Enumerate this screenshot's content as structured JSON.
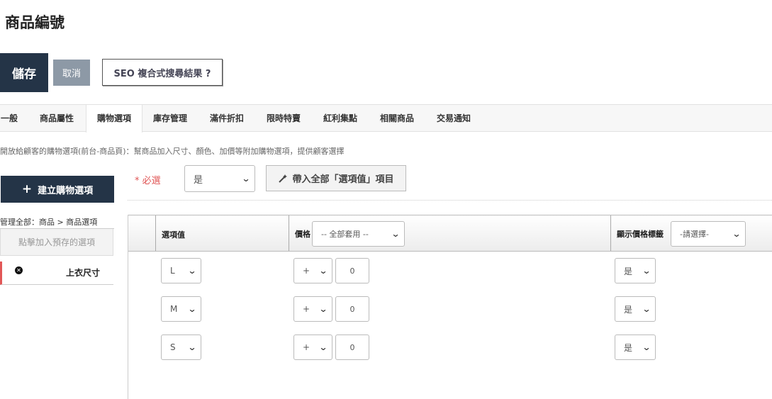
{
  "page": {
    "title": "商品編號"
  },
  "actions": {
    "save": "儲存",
    "cancel": "取消",
    "seo": "SEO 複合式搜尋結果 ?"
  },
  "tabs": [
    {
      "label": "一般"
    },
    {
      "label": "商品屬性"
    },
    {
      "label": "購物選項",
      "active": true
    },
    {
      "label": "庫存管理"
    },
    {
      "label": "滿件折扣"
    },
    {
      "label": "限時特賣"
    },
    {
      "label": "紅利集點"
    },
    {
      "label": "相關商品"
    },
    {
      "label": "交易通知"
    }
  ],
  "description": "開放給顧客的購物選項(前台-商品頁)：幫商品加入尺寸、顏色、加價等附加購物選項，提供顧客選擇",
  "sidebar": {
    "create_button": "建立購物選項",
    "breadcrumb": "管理全部：商品 > 商品選項",
    "preset_button": "點擊加入預存的選項",
    "options": [
      {
        "label": "上衣尺寸"
      }
    ]
  },
  "editor": {
    "required_label": "* 必選",
    "required_value": "是",
    "import_button": "帶入全部「選項值」項目",
    "columns": {
      "value": "選項值",
      "price": "價格",
      "price_apply": "-- 全部套用 --",
      "show_price_tag": "顯示價格標籤",
      "show_price_select": "-請選擇-"
    },
    "rows": [
      {
        "value": "L",
        "sign": "+",
        "price": "0",
        "show": "是"
      },
      {
        "value": "M",
        "sign": "+",
        "price": "0",
        "show": "是"
      },
      {
        "value": "S",
        "sign": "+",
        "price": "0",
        "show": "是"
      }
    ]
  },
  "colors": {
    "dark": "#243447",
    "cancel": "#8d99a6",
    "required": "#e05555",
    "accent_border": "#e25757"
  }
}
